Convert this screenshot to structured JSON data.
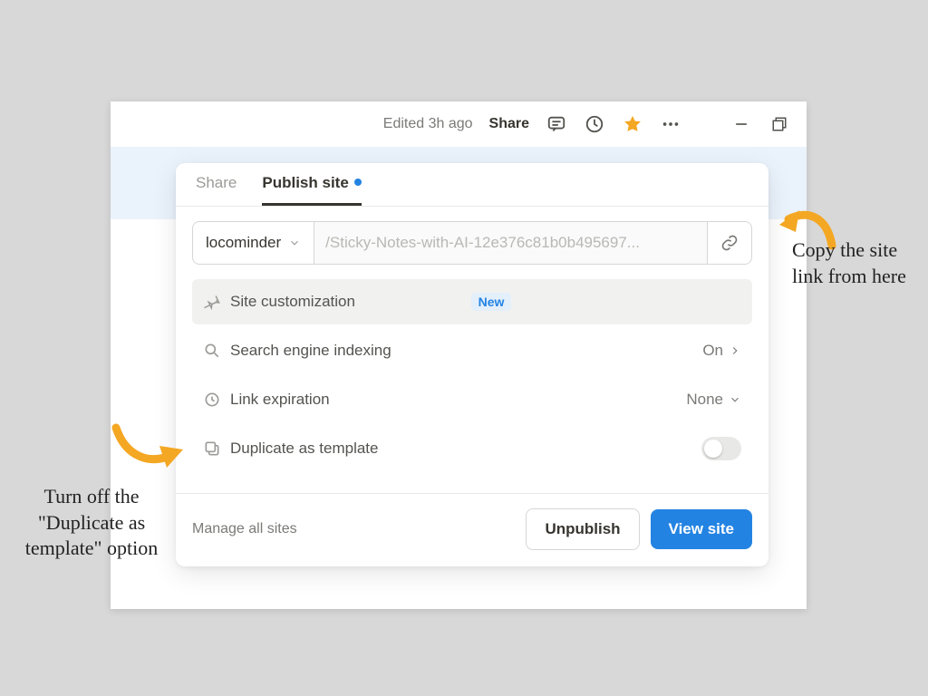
{
  "titlebar": {
    "edited_label": "Edited 3h ago",
    "share_label": "Share"
  },
  "popover": {
    "tabs": {
      "share": "Share",
      "publish": "Publish site"
    },
    "domain": "locominder",
    "path": "/Sticky-Notes-with-AI-12e376c81b0b495697...",
    "rows": {
      "customization": {
        "label": "Site customization",
        "badge": "New"
      },
      "indexing": {
        "label": "Search engine indexing",
        "value": "On"
      },
      "expiration": {
        "label": "Link expiration",
        "value": "None"
      },
      "duplicate": {
        "label": "Duplicate as template"
      }
    },
    "footer": {
      "manage": "Manage all sites",
      "unpublish": "Unpublish",
      "view": "View site"
    }
  },
  "annotations": {
    "copy": "Copy the site link from here",
    "duplicate": "Turn off the \"Duplicate as template\" option"
  }
}
